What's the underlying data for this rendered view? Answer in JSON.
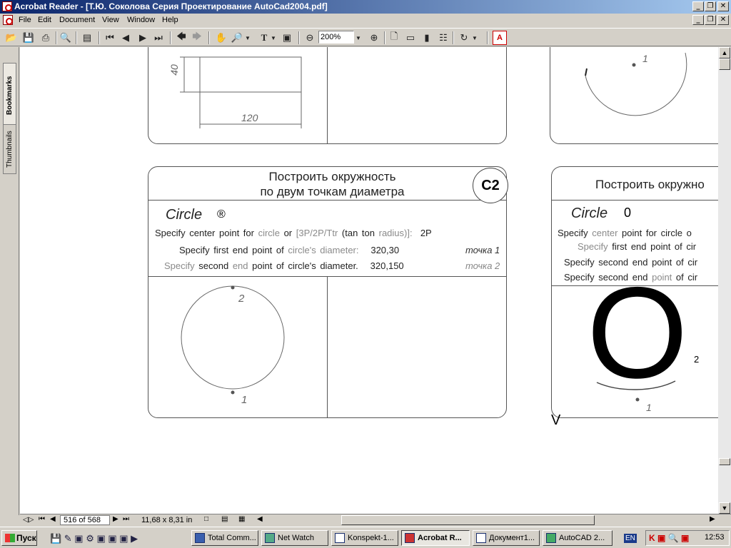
{
  "window": {
    "title": "Acrobat Reader - [Т.Ю. Соколова Серия Проектирование AutoCad2004.pdf]",
    "controls": [
      "_",
      "❐",
      "✕"
    ]
  },
  "menu": [
    "File",
    "Edit",
    "Document",
    "View",
    "Window",
    "Help"
  ],
  "toolbar": {
    "zoom": "200%"
  },
  "navpanel": {
    "tabs": [
      "Bookmarks",
      "Thumbnails"
    ]
  },
  "page": {
    "top_left_card": {
      "dim_height": "40",
      "dim_width": "120"
    },
    "top_right_card": {
      "point_label": "1"
    },
    "card_c2": {
      "title_line1": "Построить окружность",
      "title_line2": "по двум точкам диаметра",
      "badge": "C2",
      "command": "Circle",
      "reg": "®",
      "line1": {
        "a": "Specify center point for",
        "b": "circle",
        "c": "or",
        "d": "[3P/2P/Ttr",
        "e": "(tan ton",
        "f": "radius)]:",
        "g": "2P"
      },
      "line2": {
        "a": "Specify first end point of",
        "b": "circle's diameter:",
        "c": "320,30",
        "d": "точка 1"
      },
      "line3": {
        "a": "Specify",
        "b": "second",
        "c": "end",
        "d": "point of circle's diameter.",
        "e": "320,150",
        "f": "точка 2"
      },
      "point1": "1",
      "point2": "2"
    },
    "card_right": {
      "title": "Построить окружно",
      "command": "Circle",
      "reg": "0",
      "line1": {
        "a": "Specify",
        "b": "center",
        "c": "point for circle o"
      },
      "line2": {
        "a": "Specify",
        "b": "first end point of cir"
      },
      "line3": "Specify second end point of cir",
      "line4": {
        "a": "Specify second end",
        "b": "point",
        "c": "of cir"
      },
      "big_glyph": "O",
      "point1": "1",
      "point2": "2",
      "stray": "V"
    }
  },
  "status": {
    "page": "516 of 568",
    "size": "11,68 x 8,31 in"
  },
  "taskbar": {
    "start": "Пуск",
    "tasks": [
      "Total Comm...",
      "Net Watch",
      "Konspekt-1...",
      "Acrobat R...",
      "Документ1...",
      "AutoCAD 2..."
    ],
    "lang": "EN",
    "clock": "12:53"
  }
}
